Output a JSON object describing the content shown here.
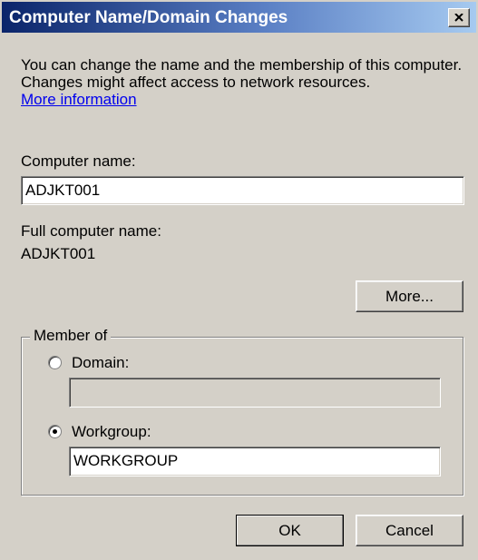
{
  "window": {
    "title": "Computer Name/Domain Changes"
  },
  "intro": {
    "description": "You can change the name and the membership of this computer. Changes might affect access to network resources.",
    "more_info_link": "More information"
  },
  "computer_name": {
    "label": "Computer name:",
    "value": "ADJKT001"
  },
  "full_computer_name": {
    "label": "Full computer name:",
    "value": "ADJKT001"
  },
  "buttons": {
    "more": "More...",
    "ok": "OK",
    "cancel": "Cancel"
  },
  "member_of": {
    "legend": "Member of",
    "domain_label": "Domain:",
    "domain_value": "",
    "domain_selected": false,
    "workgroup_label": "Workgroup:",
    "workgroup_value": "WORKGROUP",
    "workgroup_selected": true
  }
}
